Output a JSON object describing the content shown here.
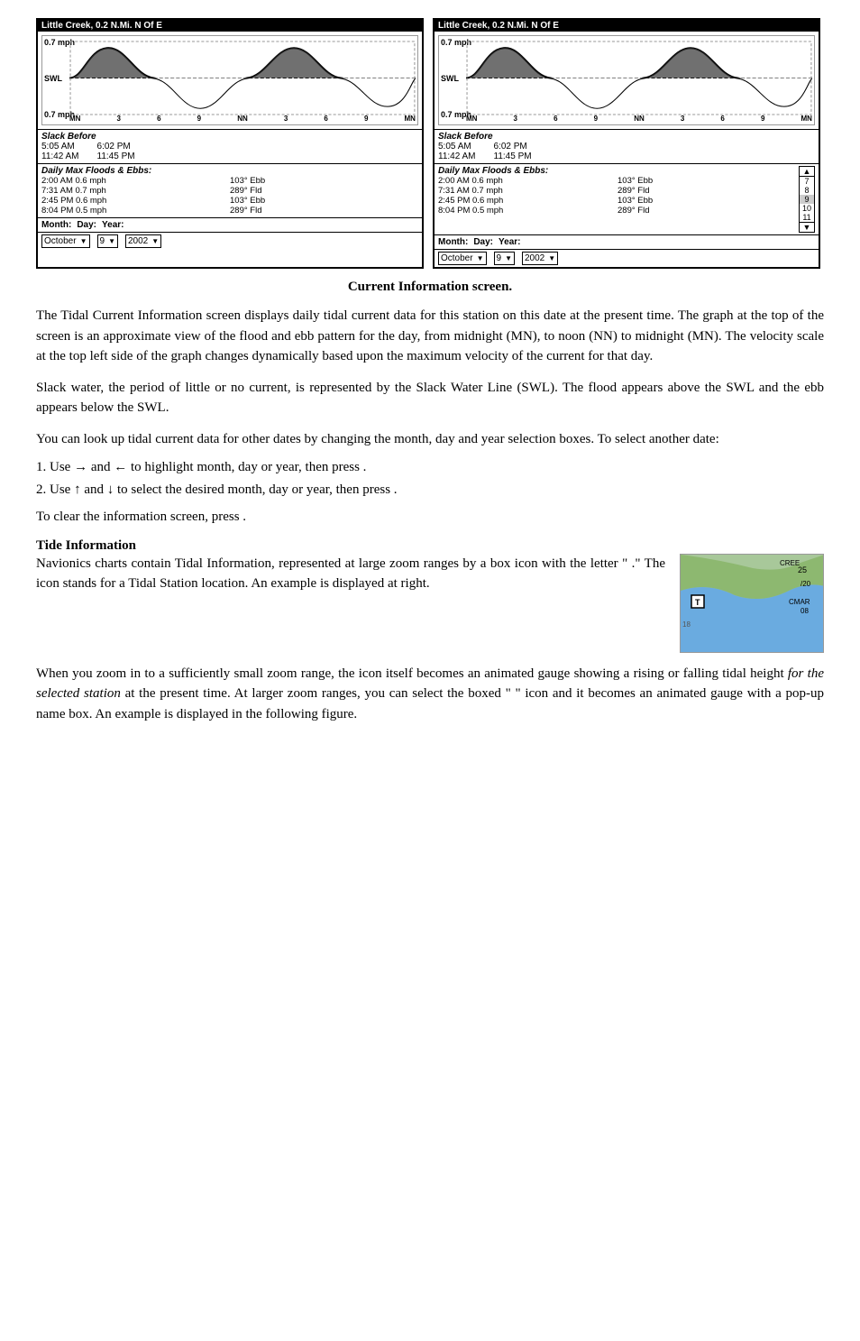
{
  "caption": "Current Information screen.",
  "panels": [
    {
      "title": "Little Creek, 0.2 N.Mi. N Of E",
      "velocity_top": "0.7 mph",
      "swl": "SWL",
      "velocity_bot": "0.7 mph",
      "x_labels": [
        "MN",
        "3",
        "6",
        "9",
        "NN",
        "3",
        "6",
        "9",
        "MN"
      ],
      "slack_title": "Slack Before",
      "slack_times": [
        {
          "time": "5:05 AM",
          "period": ""
        },
        {
          "time": "6:02 PM",
          "period": ""
        }
      ],
      "slack_times2": [
        {
          "time": "11:42 AM",
          "period": ""
        },
        {
          "time": "11:45 PM",
          "period": ""
        }
      ],
      "floods_title": "Daily Max Floods & Ebbs:",
      "floods": [
        {
          "time": "2:00 AM 0.6 mph",
          "dir": "103° Ebb"
        },
        {
          "time": "7:31 AM 0.7 mph",
          "dir": "289° Fld"
        },
        {
          "time": "2:45 PM 0.6 mph",
          "dir": "103° Ebb"
        },
        {
          "time": "8:04 PM 0.5 mph",
          "dir": "289° Fld"
        }
      ],
      "month_label": "Month:",
      "day_label": "Day:",
      "year_label": "Year:",
      "month_value": "October",
      "day_value": "9",
      "year_value": "2002",
      "has_scroll": false
    },
    {
      "title": "Little Creek, 0.2 N.Mi. N Of E",
      "velocity_top": "0.7 mph",
      "swl": "SWL",
      "velocity_bot": "0.7 mph",
      "x_labels": [
        "MN",
        "3",
        "6",
        "9",
        "NN",
        "3",
        "6",
        "9",
        "MN"
      ],
      "slack_title": "Slack Before",
      "slack_times": [
        {
          "time": "5:05 AM",
          "period": ""
        },
        {
          "time": "6:02 PM",
          "period": ""
        }
      ],
      "slack_times2": [
        {
          "time": "11:42 AM",
          "period": ""
        },
        {
          "time": "11:45 PM",
          "period": ""
        }
      ],
      "floods_title": "Daily Max Floods",
      "floods": [
        {
          "time": "2:00 AM 0.6 mph",
          "dir": "103° Ebb"
        },
        {
          "time": "7:31 AM 0.7 mph",
          "dir": "289° Fld"
        },
        {
          "time": "2:45 PM 0.6 mph",
          "dir": "103° Ebb"
        },
        {
          "time": "8:04 PM 0.5 mph",
          "dir": "289° Fld"
        }
      ],
      "scroll_items": [
        "7",
        "8",
        "9",
        "10",
        "11"
      ],
      "month_label": "Month:",
      "day_label": "Day:",
      "year_label": "Year:",
      "month_value": "October",
      "day_value": "9",
      "year_value": "2002",
      "has_scroll": true
    }
  ],
  "body_paragraphs": [
    "The Tidal Current Information screen displays daily tidal current data for this station on this date at the present time. The graph at the top of the screen is an approximate view of the flood and ebb pattern for the day, from midnight (MN), to noon (NN) to midnight (MN). The velocity scale at the top left side of the graph changes dynamically based upon the maximum velocity of the current for that day.",
    "Slack water, the period of little or no current, is represented by the Slack Water Line (SWL). The flood appears above the SWL and the ebb appears below the SWL.",
    "You can look up tidal current data for other dates by changing the month, day and year selection boxes. To select another date:"
  ],
  "numbered_items": [
    "1. Use → and ← to highlight month, day or year, then press       .",
    "2. Use ↑ and ↓ to select the desired month, day or year, then press       ."
  ],
  "clear_text": "To clear the information screen, press       .",
  "tide_info_heading": "Tide Information",
  "tide_info_text": "Navionics charts contain Tidal Information, represented at large zoom ranges by a box icon with the letter \" .\" The icon stands for a Tidal Station location. An example is displayed at right.",
  "tide_info_text2_before": "When you zoom in to a sufficiently small zoom range, the icon itself becomes an animated gauge showing a rising or falling tidal height ",
  "tide_info_text2_italic": "for the selected station",
  "tide_info_text2_after": " at the present time. At larger zoom ranges, you can select the boxed \" \" icon and it becomes an animated gauge with a pop-up name box. An example is displayed in the following figure."
}
